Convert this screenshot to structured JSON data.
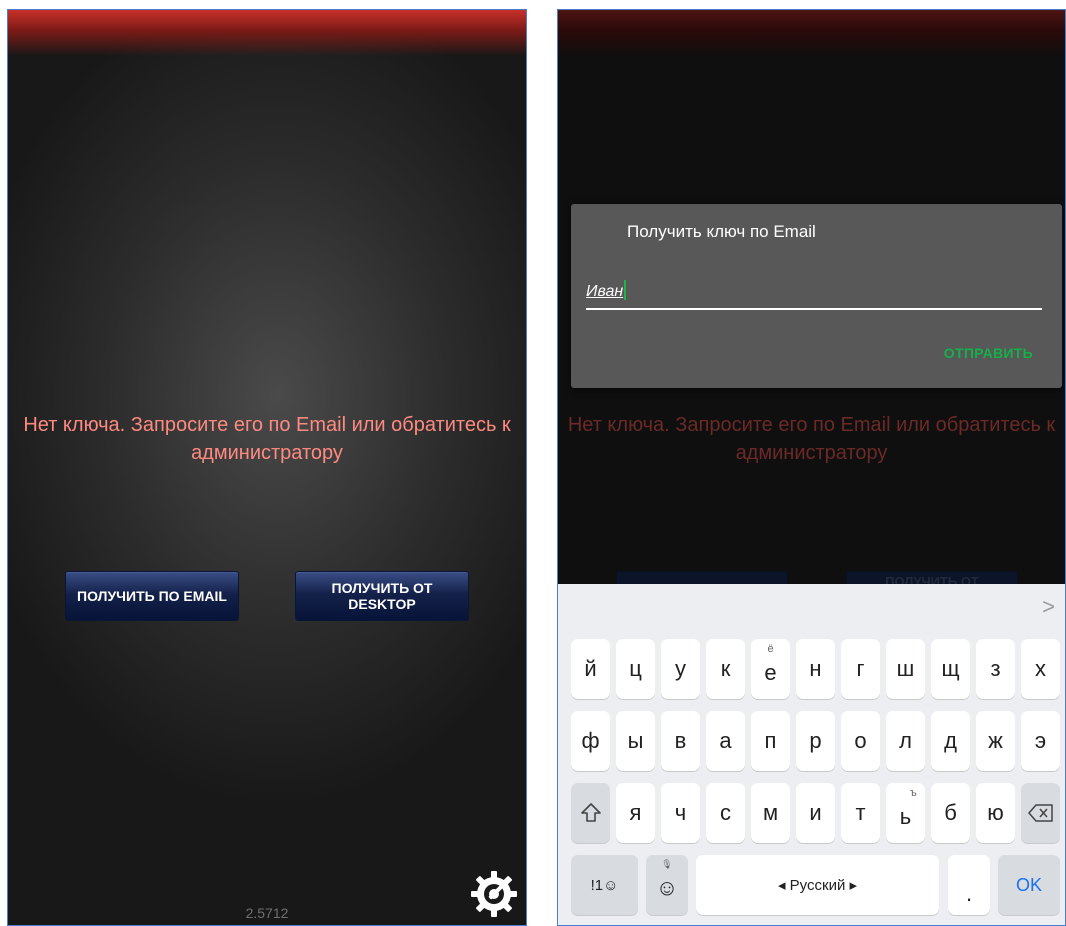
{
  "left_screen": {
    "message": "Нет ключа. Запросите его по Email или обратитесь к администратору",
    "buttons": {
      "email": "ПОЛУЧИТЬ ПО EMAIL",
      "desktop_line1": "ПОЛУЧИТЬ ОТ",
      "desktop_line2": "DESKTOP"
    },
    "version": "2.5712",
    "settings_icon": "gear-wrench-icon"
  },
  "right_screen": {
    "message": "Нет ключа. Запросите его по Email или обратитесь к администратору",
    "faded_button_desktop": "ПОЛУЧИТЬ ОТ",
    "dialog": {
      "title": "Получить ключ по Email",
      "input_value": "Иван",
      "send_label": "ОТПРАВИТЬ"
    },
    "keyboard": {
      "row1": [
        "й",
        "ц",
        "у",
        "к",
        "е",
        "н",
        "г",
        "ш",
        "щ",
        "з",
        "х"
      ],
      "row1_hint_e": "ё",
      "row2": [
        "ф",
        "ы",
        "в",
        "а",
        "п",
        "р",
        "о",
        "л",
        "д",
        "ж",
        "э"
      ],
      "row3": [
        "я",
        "ч",
        "с",
        "м",
        "и",
        "т",
        "ь",
        "б",
        "ю"
      ],
      "row3_hint_soft": "ъ",
      "symbols_key": "!1☺",
      "emoji_key": "☺",
      "space_label": "◂ Русский ▸",
      "period_key": ".",
      "ok_key": "OK",
      "suggest_arrow": ">"
    }
  },
  "colors": {
    "message_red": "#ff8a80",
    "send_green": "#14b048",
    "button_navy": "#071337"
  }
}
